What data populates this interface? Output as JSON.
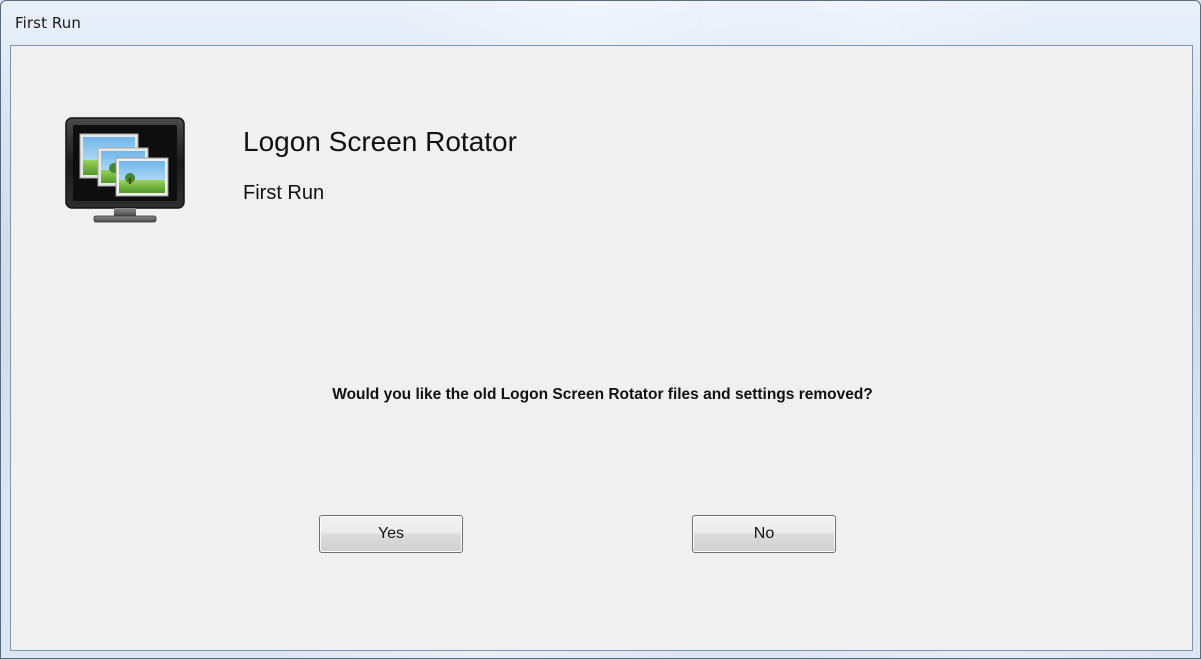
{
  "window": {
    "title": "First Run"
  },
  "header": {
    "app_title": "Logon Screen Rotator",
    "subtitle": "First Run",
    "icon": "monitor-with-pictures-icon"
  },
  "main": {
    "question": "Would you like the old Logon Screen Rotator files and settings removed?"
  },
  "buttons": {
    "yes_label": "Yes",
    "no_label": "No"
  },
  "colors": {
    "client_background": "#f0f0f0",
    "frame_glass": "#d7e4f2",
    "button_border": "#707070"
  }
}
